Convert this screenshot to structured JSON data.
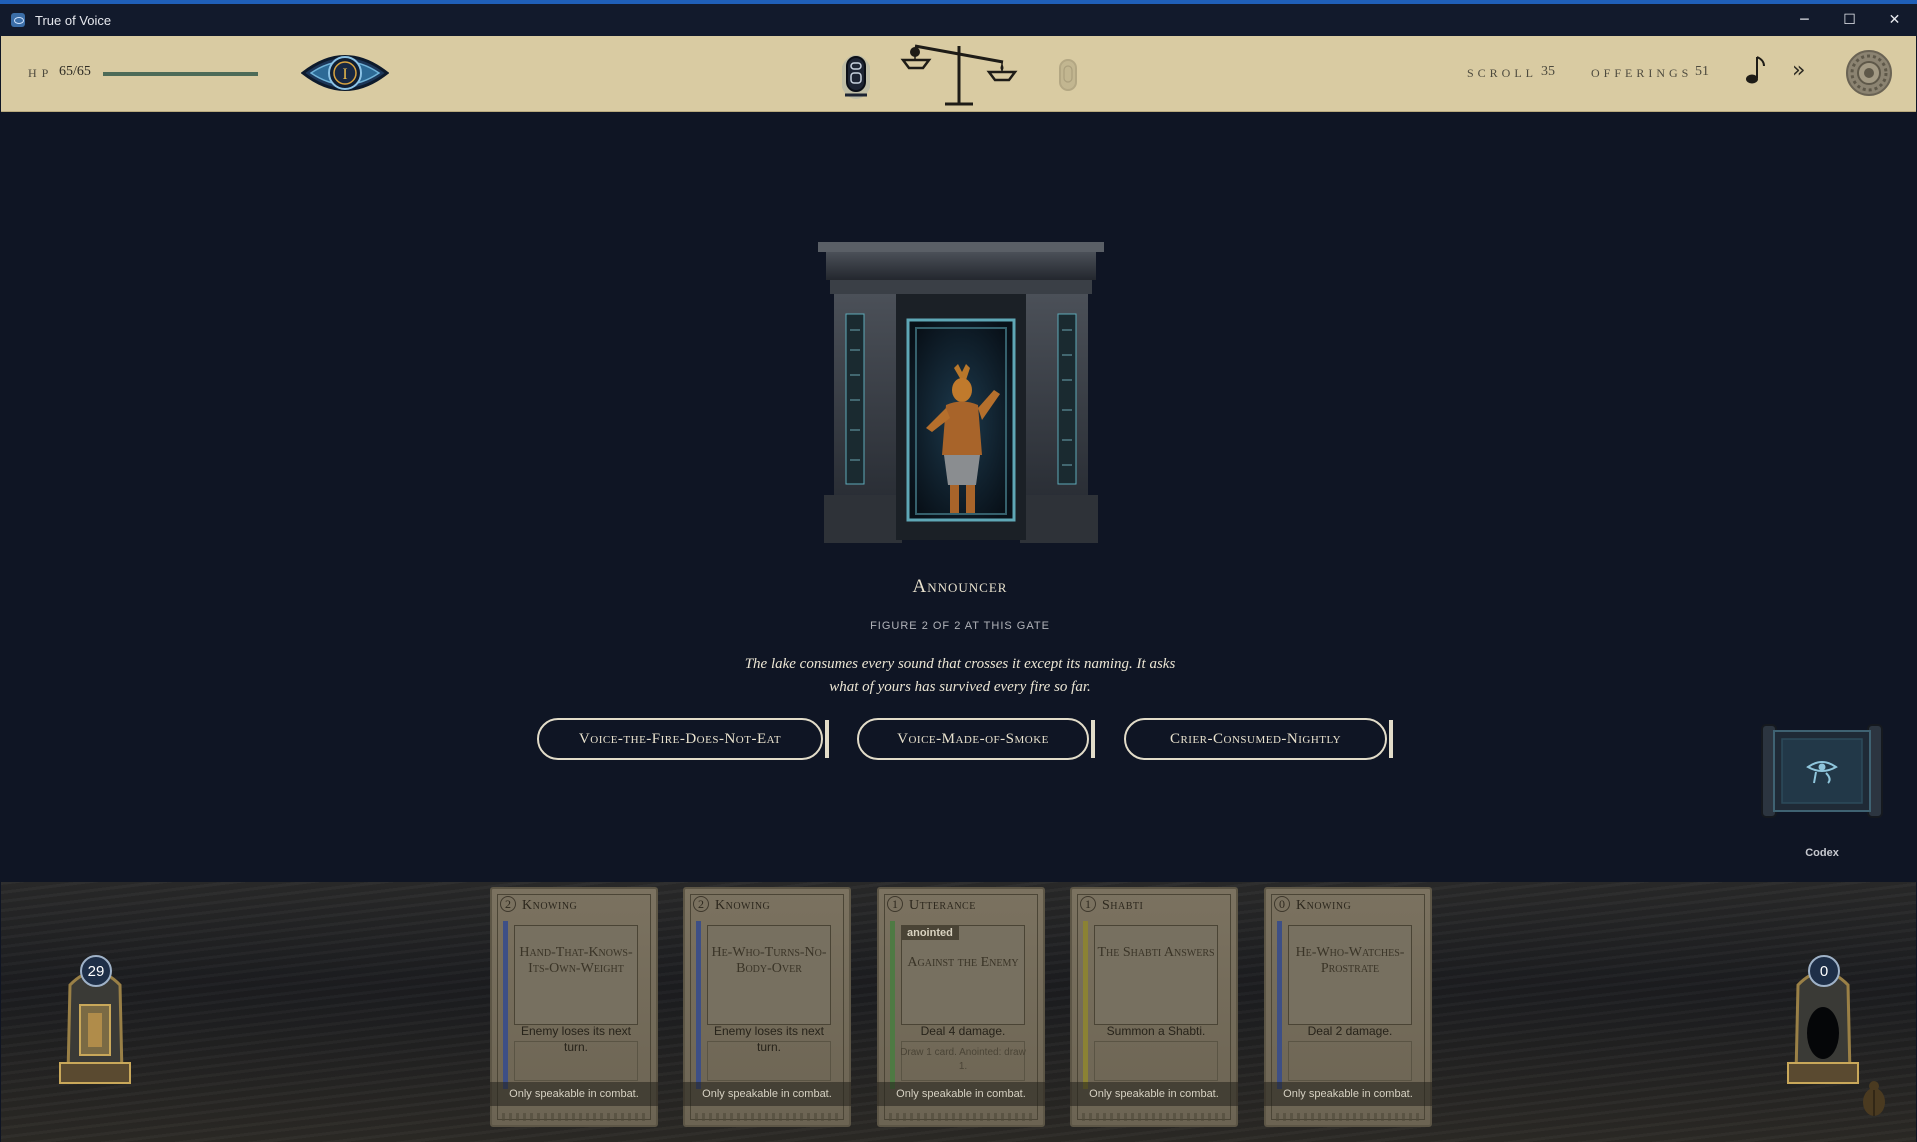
{
  "window": {
    "title": "True of Voice",
    "controls": {
      "minimize": "─",
      "maximize": "☐",
      "close": "✕"
    }
  },
  "hud": {
    "hp_label": "HP",
    "hp_value": "65/65",
    "hp_fraction": 1.0,
    "eye_emblem_numeral": "I",
    "scroll_label": "SCROLL",
    "scroll_value": "35",
    "offerings_label": "OFFERINGS",
    "offerings_value": "51",
    "skip_glyph": "»",
    "icons": [
      "eye-of-ra-icon",
      "cartouche-icon",
      "scales-icon",
      "music-note-icon",
      "settings-gear-icon"
    ]
  },
  "encounter": {
    "figure_name": "Announcer",
    "figure_count": "FIGURE 2 OF 2 AT THIS GATE",
    "text": "The lake consumes every sound that crosses it except its naming. It asks what of yours has survived every fire so far.",
    "choices": [
      {
        "label": "Voice-the-Fire-Does-Not-Eat"
      },
      {
        "label": "Voice-Made-of-Smoke"
      },
      {
        "label": "Crier-Consumed-Nightly"
      }
    ]
  },
  "codex": {
    "label": "Codex",
    "icon": "eye-of-horus-icon"
  },
  "piles": {
    "draw_count": "29",
    "discard_count": "0"
  },
  "colors": {
    "accent_hud": "#d9cba2",
    "background": "#0f1524",
    "hp_fill": "#4d6b58",
    "knowing_stripe": "#3d4f86",
    "utterance_stripe": "#4e7a43",
    "shabti_stripe": "#8b8234"
  },
  "hand": [
    {
      "cost": "2",
      "type": "Knowing",
      "name": "Hand-That-Knows-Its-Own-Weight",
      "tag": "",
      "effect": "Enemy loses its next turn.",
      "subeffect": "",
      "restriction": "Only speakable in combat.",
      "stripe": "#3d4f86"
    },
    {
      "cost": "2",
      "type": "Knowing",
      "name": "He-Who-Turns-No-Body-Over",
      "tag": "",
      "effect": "Enemy loses its next turn.",
      "subeffect": "",
      "restriction": "Only speakable in combat.",
      "stripe": "#3d4f86"
    },
    {
      "cost": "1",
      "type": "Utterance",
      "name": "Against the Enemy",
      "tag": "anointed",
      "effect": "Deal 4 damage.",
      "subeffect": "Draw 1 card. Anointed: draw 1.",
      "restriction": "Only speakable in combat.",
      "stripe": "#4e7a43"
    },
    {
      "cost": "1",
      "type": "Shabti",
      "name": "The Shabti Answers",
      "tag": "",
      "effect": "Summon a Shabti.",
      "subeffect": "",
      "restriction": "Only speakable in combat.",
      "stripe": "#8b8234"
    },
    {
      "cost": "0",
      "type": "Knowing",
      "name": "He-Who-Watches-Prostrate",
      "tag": "",
      "effect": "Deal 2 damage.",
      "subeffect": "",
      "restriction": "Only speakable in combat.",
      "stripe": "#3d4f86"
    }
  ]
}
